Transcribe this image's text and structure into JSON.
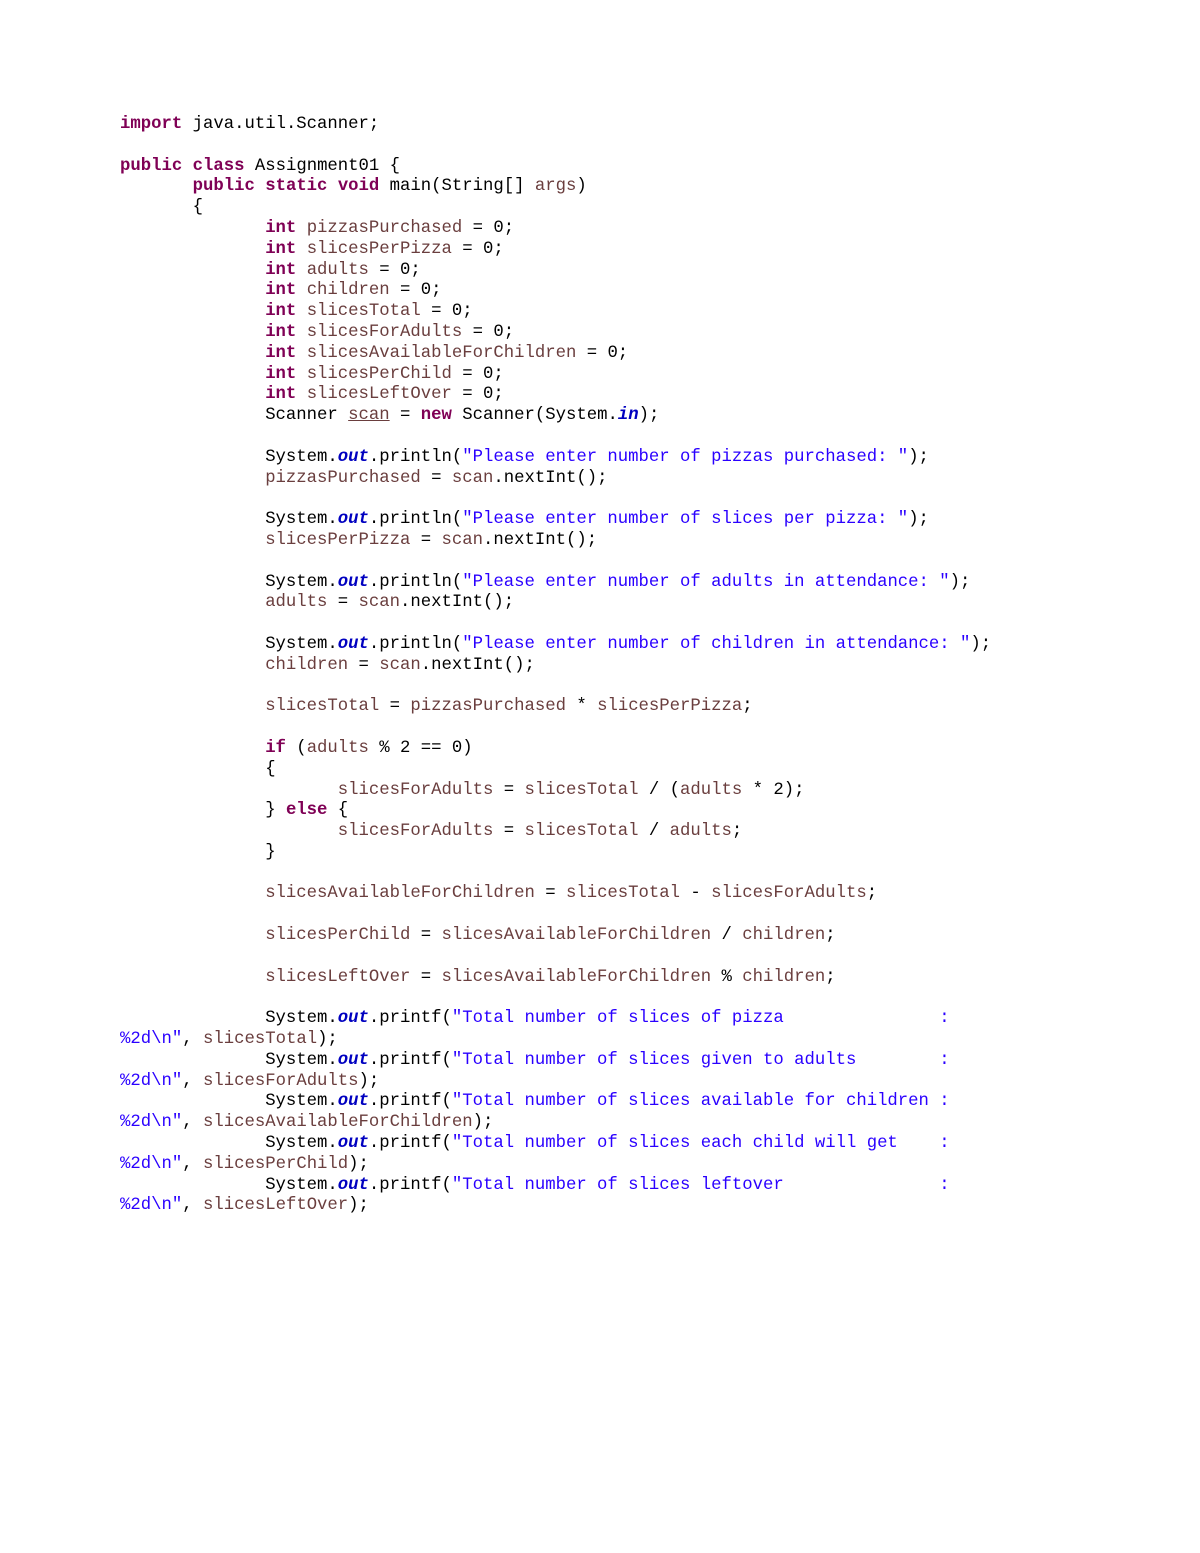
{
  "tokens": {
    "kw_import": "import",
    "kw_public": "public",
    "kw_class": "class",
    "kw_static": "static",
    "kw_void": "void",
    "kw_int": "int",
    "kw_new": "new",
    "kw_if": "if",
    "kw_else": "else",
    "import_pkg": " java.util.Scanner;",
    "class_name": "Assignment01",
    "main_sig_a": " main(String[] ",
    "main_sig_args": "args",
    "main_sig_b": ")",
    "decl_pizzas_a": " ",
    "pizzasPurchased": "pizzasPurchased",
    "eq0": " = 0;",
    "slicesPerPizza": "slicesPerPizza",
    "adults": "adults",
    "children": "children",
    "slicesTotal": "slicesTotal",
    "slicesForAdults": "slicesForAdults",
    "slicesAvailableForChildren": "slicesAvailableForChildren",
    "slicesPerChild": "slicesPerChild",
    "slicesLeftOver": "slicesLeftOver",
    "scanner_a": "Scanner ",
    "scan": "scan",
    "scanner_b": " = ",
    "scanner_c": " Scanner(System.",
    "in_field": "in",
    "scanner_d": ");",
    "sys_a": "System.",
    "out_field": "out",
    "println": ".println(",
    "printf": ".printf(",
    "close_paren_semi": ");",
    "str_pizzas": "\"Please enter number of pizzas purchased: \"",
    "str_slices": "\"Please enter number of slices per pizza: \"",
    "str_adults": "\"Please enter number of adults in attendance: \"",
    "str_children": "\"Please enter number of children in attendance: \"",
    "assign_nextInt_a": " = ",
    "scan_nextInt": "scan",
    "nextInt_b": ".nextInt();",
    "calc_slicesTotal": " = ",
    "pizzasPurchased2": "pizzasPurchased",
    "times": " * ",
    "slicesPerPizza2": "slicesPerPizza",
    "semi": ";",
    "if_open": " (",
    "adults_mod": "adults",
    "mod2eq0": " % 2 == 0)",
    "lbrace": "{",
    "rbrace": "}",
    "sfa_assign": "slicesForAdults",
    "eq": " = ",
    "slicesTotal_a": "slicesTotal",
    "div_adults2": " / (",
    "adults_b": "adults",
    "times2": " * 2);",
    "else_sp": " ",
    "div_adults": " / ",
    "adults_c": "adults",
    "semi2": ";",
    "safc": "slicesAvailableForChildren",
    "minus": " - ",
    "spc": "slicesPerChild",
    "div": " / ",
    "slo": "slicesLeftOver",
    "mod": " % ",
    "str_totalSlices": "\"Total number of slices of pizza               : %2d\\n\"",
    "str_toAdults": "\"Total number of slices given to adults        : %2d\\n\"",
    "str_forChildren": "\"Total number of slices available for children : %2d\\n\"",
    "str_eachChild": "\"Total number of slices each child will get    : %2d\\n\"",
    "str_leftover": "\"Total number of slices leftover               : %2d\\n\"",
    "comma_sp": ", "
  },
  "indent": {
    "i1": "       ",
    "i2": "              ",
    "i3": "                     "
  }
}
